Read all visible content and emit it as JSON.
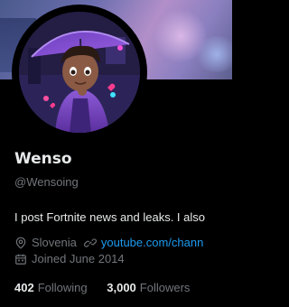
{
  "profile": {
    "display_name": "Wenso",
    "handle": "@Wensoing",
    "bio": "I post Fortnite news and leaks. I also",
    "location": "Slovenia",
    "website": "youtube.com/chann",
    "joined": "Joined June 2014"
  },
  "stats": {
    "following_count": "402",
    "following_label": "Following",
    "followers_count": "3,000",
    "followers_label": "Followers"
  },
  "icons": {
    "location": "location-pin-icon",
    "link": "link-icon",
    "calendar": "calendar-icon"
  },
  "colors": {
    "background": "#000000",
    "primary_text": "#e7e9ea",
    "secondary_text": "#71767b",
    "link": "#1d9bf0"
  }
}
